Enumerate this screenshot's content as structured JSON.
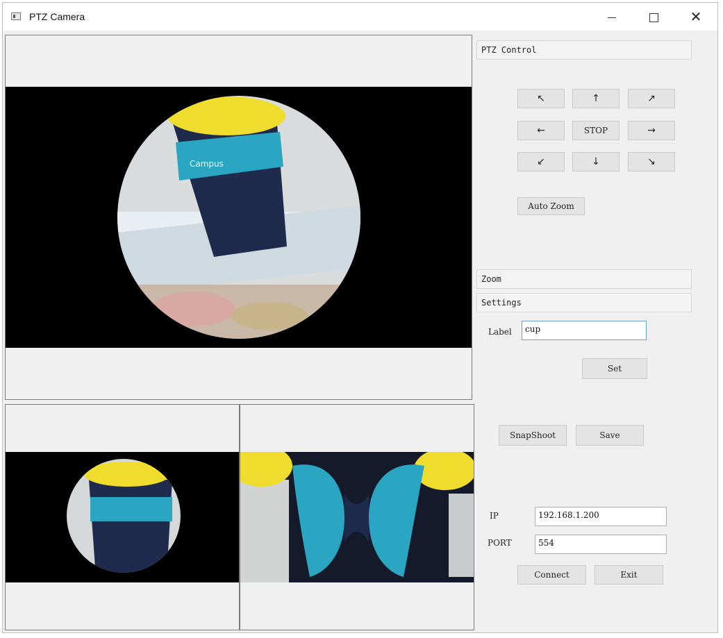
{
  "window": {
    "title": "PTZ Camera",
    "icons": {
      "app": "app-icon",
      "minimize": "minimize-icon",
      "maximize": "maximize-icon",
      "close": "close-icon"
    }
  },
  "ptz": {
    "header": "PTZ Control",
    "up_left": "↖",
    "up": "↑",
    "up_right": "↗",
    "left": "←",
    "stop": "STOP",
    "right": "→",
    "down_left": "↙",
    "down": "↓",
    "down_right": "↘",
    "auto_zoom": "Auto Zoom"
  },
  "zoom": {
    "header": "Zoom"
  },
  "settings": {
    "header": "Settings",
    "label_caption": "Label",
    "label_value": "cup",
    "set": "Set"
  },
  "actions": {
    "snapshot": "SnapShoot",
    "save": "Save"
  },
  "connection": {
    "ip_caption": "IP",
    "ip_value": "192.168.1.200",
    "port_caption": "PORT",
    "port_value": "554",
    "connect": "Connect",
    "exit": "Exit"
  },
  "colors": {
    "cup_yellow": "#f0dc2c",
    "cup_navy": "#1f2b4d",
    "cup_teal": "#2aa6c2",
    "video_bg": "#000000",
    "window_frame": "#9ccfc0"
  }
}
